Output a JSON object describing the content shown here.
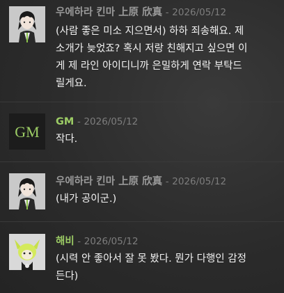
{
  "messages": [
    {
      "author": "우에하라 킨마 上原 欣真",
      "timestamp": "2026/05/12",
      "text": "(사람 좋은 미소 지으면서) 하하 죄송해요. 제\n소개가 늦었죠? 혹시 저랑 친해지고 싶으면 이\n게 제 라인 아이디니까 은밀하게 연락 부탁드\n릴게요.",
      "avatar": "dark-haired-boy-avatar"
    },
    {
      "author": "GM",
      "timestamp": "2026/05/12",
      "text": "작다.",
      "avatar_text": "GM"
    },
    {
      "author": "우에하라 킨마 上原 欣真",
      "timestamp": "2026/05/12",
      "text": "(내가 공이군.)",
      "avatar": "dark-haired-boy-avatar"
    },
    {
      "author": "해비",
      "timestamp": "2026/05/12",
      "text": "(시력 안 좋아서 잘 못 봤다. 뭔가 다행인 감정\n든다)",
      "avatar": "green-creature-avatar"
    }
  ],
  "colors": {
    "background": "#2b2b2b",
    "gm_name": "#9ccc65",
    "player_name": "#9a9a9a",
    "timestamp": "#7d7d7d"
  }
}
